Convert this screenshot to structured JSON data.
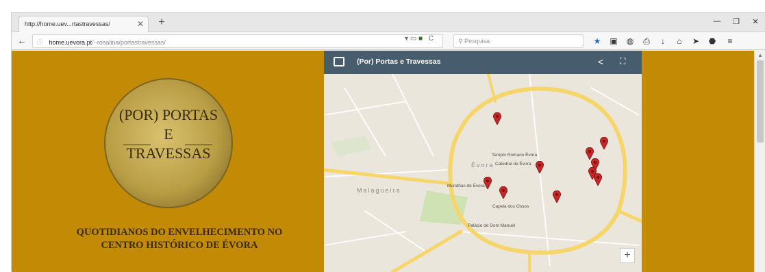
{
  "browser": {
    "tab_title": "http://home.uev...rtastravessas/",
    "tab_close": "✕",
    "new_tab": "+",
    "window": {
      "minimize": "—",
      "restore": "❐",
      "close": "✕"
    },
    "url": {
      "host": "home.uevora.pt",
      "path": "/~rosalina/portastravessas/"
    },
    "search_placeholder": "Pesquisa"
  },
  "page": {
    "logo": {
      "line1": "(POR) PORTAS",
      "line2": "E",
      "line3": "TRAVESSAS"
    },
    "subtitle": {
      "line1": "QUOTIDIANOS DO ENVELHECIMENTO NO",
      "line2": "CENTRO HISTÓRICO DE ÉVORA"
    },
    "background": "#c38a06"
  },
  "map": {
    "title": "(Por) Portas e Travessas",
    "zoom_in": "+",
    "labels": {
      "templo": "Templo Romano Évora",
      "catedral": "Catedral de Évora",
      "evora": "Évora",
      "capela": "Capela dos Ossos",
      "palacio": "Palácio de Dom Manuel",
      "muralhas": "Muralhas de Évora",
      "malagueira": "Malagueira"
    },
    "pin_color": "#c62828",
    "road_color": "#f6d66a"
  }
}
